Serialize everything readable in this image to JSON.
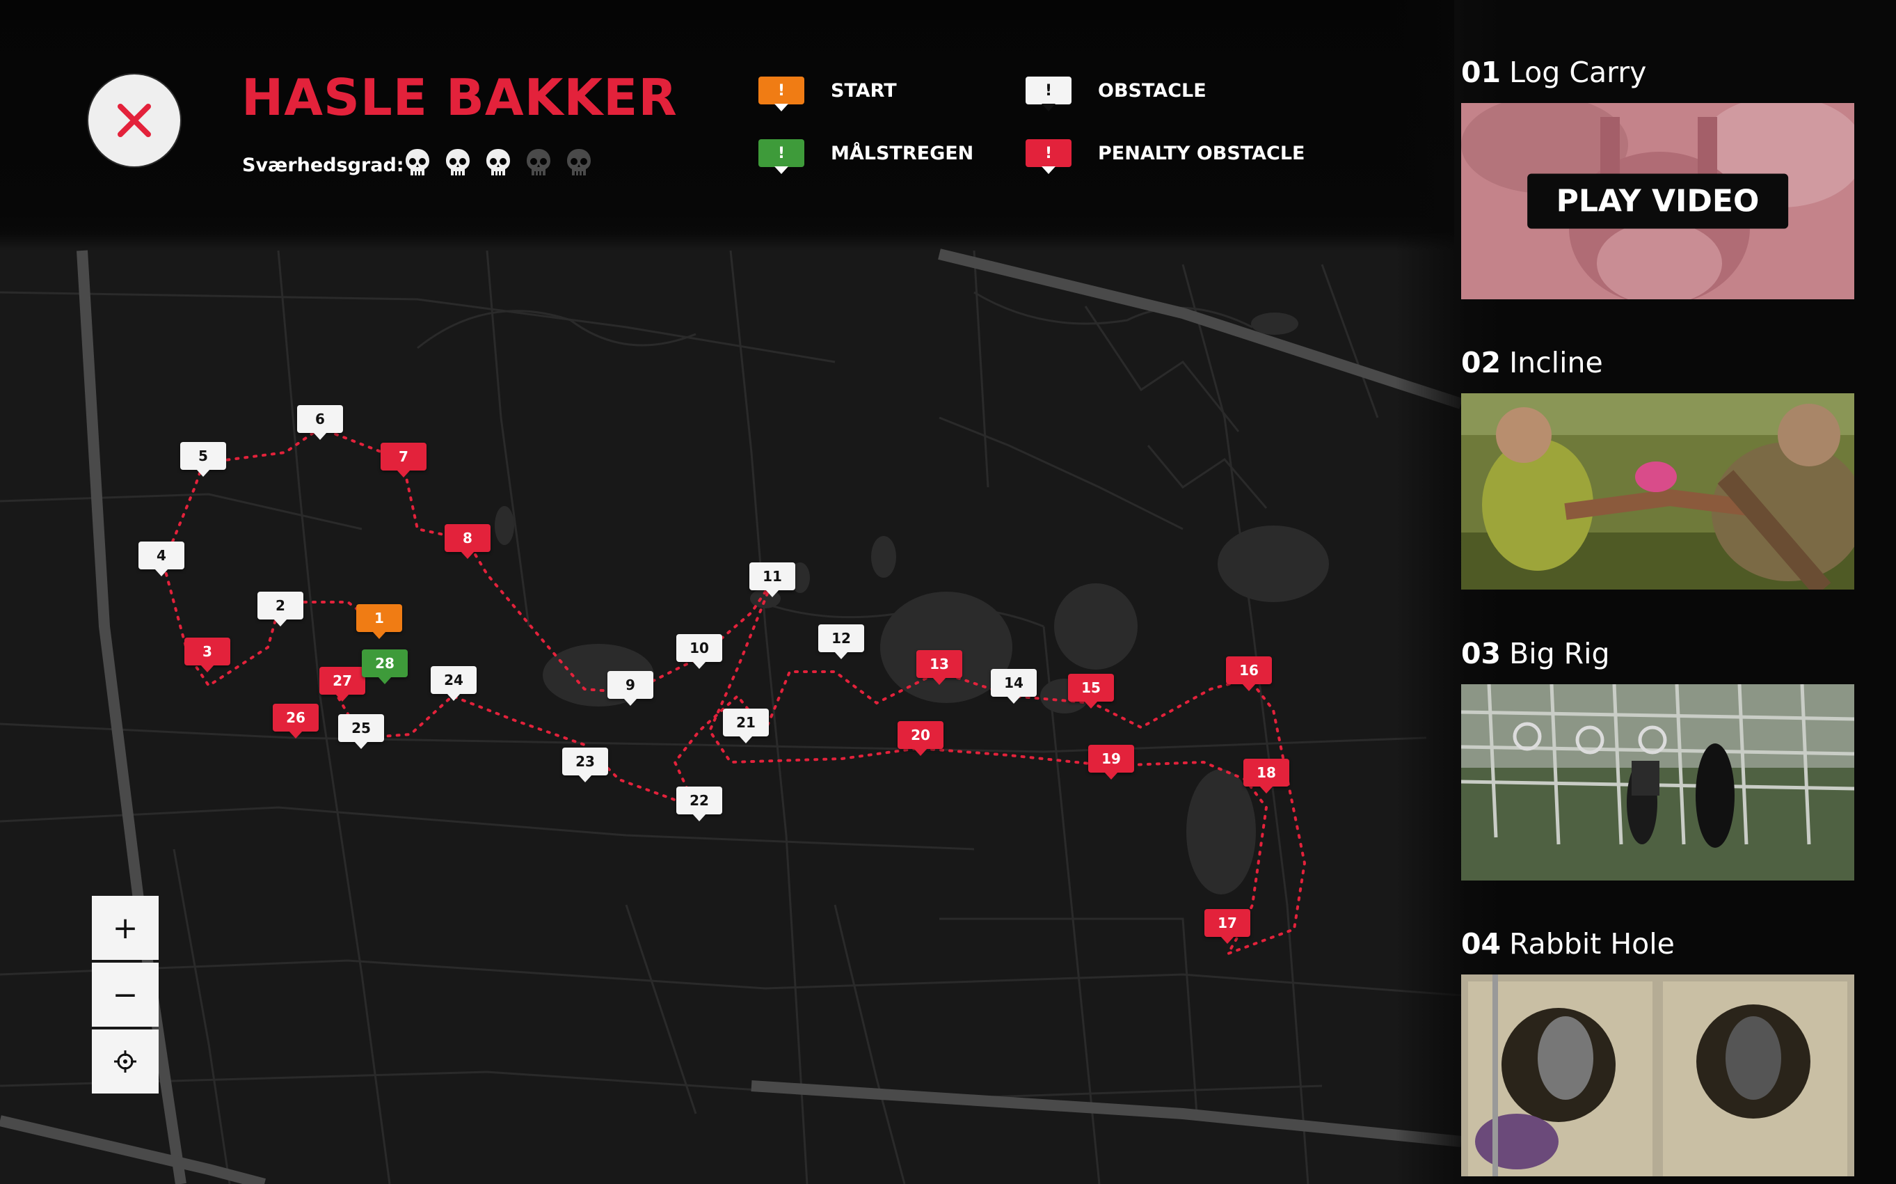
{
  "header": {
    "title": "HASLE BAKKER",
    "difficulty_label": "Sværhedsgrad:",
    "difficulty_level": 3,
    "difficulty_max": 5,
    "close_icon": "close-icon"
  },
  "legend": [
    {
      "key": "start",
      "label": "START",
      "symbol": "!",
      "color": "#f07c14"
    },
    {
      "key": "finish",
      "label": "MÅLSTREGEN",
      "symbol": "!",
      "color": "#3e9b3a"
    },
    {
      "key": "obstacle",
      "label": "OBSTACLE",
      "symbol": "!",
      "color": "#f4f4f4"
    },
    {
      "key": "penalty",
      "label": "PENALTY OBSTACLE",
      "symbol": "!",
      "color": "#e3223b"
    }
  ],
  "map": {
    "markers": [
      {
        "label": "1",
        "type": "start"
      },
      {
        "label": "2",
        "type": "obstacle"
      },
      {
        "label": "3",
        "type": "penalty"
      },
      {
        "label": "4",
        "type": "obstacle"
      },
      {
        "label": "5",
        "type": "obstacle"
      },
      {
        "label": "6",
        "type": "obstacle"
      },
      {
        "label": "7",
        "type": "penalty"
      },
      {
        "label": "8",
        "type": "penalty"
      },
      {
        "label": "9",
        "type": "obstacle"
      },
      {
        "label": "10",
        "type": "obstacle"
      },
      {
        "label": "11",
        "type": "obstacle"
      },
      {
        "label": "12",
        "type": "obstacle"
      },
      {
        "label": "13",
        "type": "penalty"
      },
      {
        "label": "14",
        "type": "obstacle"
      },
      {
        "label": "15",
        "type": "penalty"
      },
      {
        "label": "16",
        "type": "penalty"
      },
      {
        "label": "17",
        "type": "penalty"
      },
      {
        "label": "18",
        "type": "penalty"
      },
      {
        "label": "19",
        "type": "penalty"
      },
      {
        "label": "20",
        "type": "penalty"
      },
      {
        "label": "21",
        "type": "obstacle"
      },
      {
        "label": "22",
        "type": "obstacle"
      },
      {
        "label": "23",
        "type": "obstacle"
      },
      {
        "label": "24",
        "type": "obstacle"
      },
      {
        "label": "25",
        "type": "obstacle"
      },
      {
        "label": "26",
        "type": "penalty"
      },
      {
        "label": "27",
        "type": "penalty"
      },
      {
        "label": "28",
        "type": "finish"
      }
    ],
    "controls": {
      "zoom_in": "+",
      "zoom_out": "−",
      "locate_icon": "crosshair-icon"
    }
  },
  "videos": [
    {
      "number": "01",
      "title": "Log Carry",
      "play_label": "PLAY VIDEO",
      "active": true
    },
    {
      "number": "02",
      "title": "Incline"
    },
    {
      "number": "03",
      "title": "Big Rig"
    },
    {
      "number": "04",
      "title": "Rabbit Hole"
    }
  ],
  "colors": {
    "accent": "#e3223b",
    "start": "#f07c14",
    "finish": "#3e9b3a",
    "obstacle": "#f4f4f4",
    "route": "#e3223b",
    "background": "#0b0b0b"
  }
}
